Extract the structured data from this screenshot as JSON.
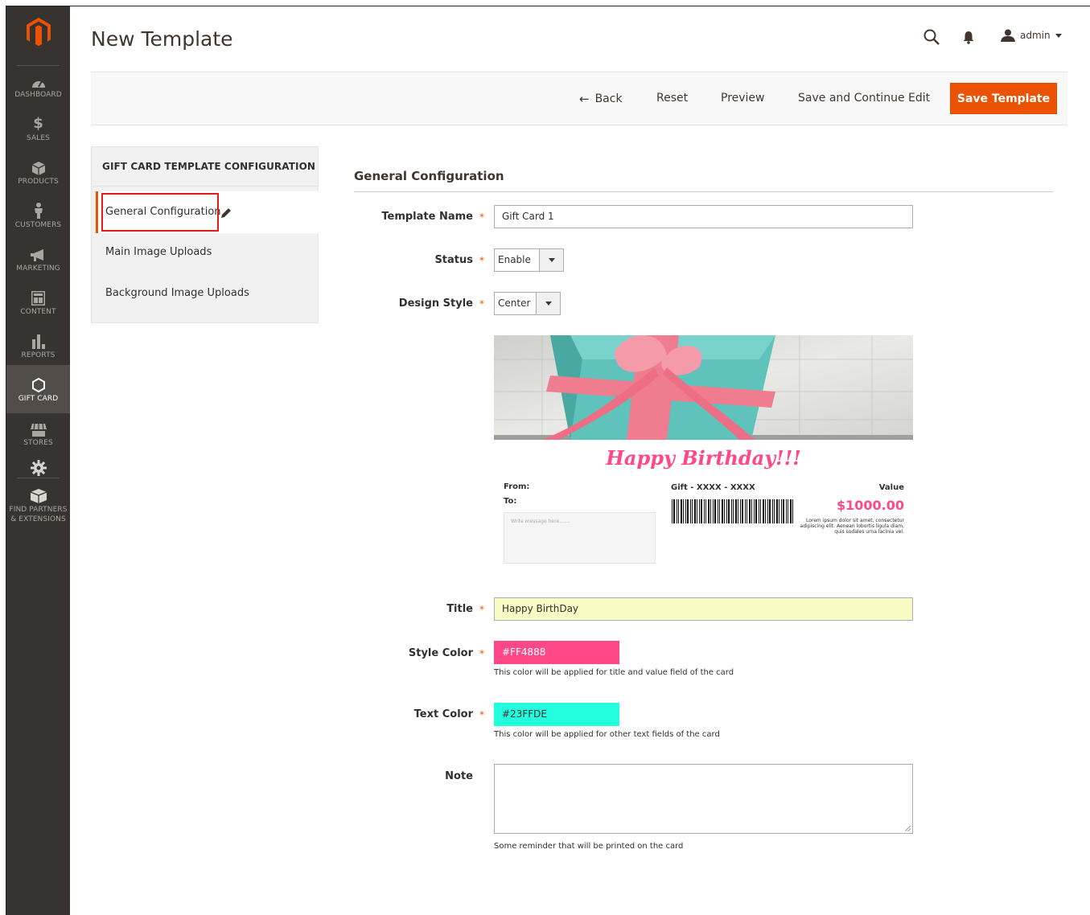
{
  "sidebar": {
    "logo": "magento-logo",
    "items": [
      {
        "label": "DASHBOARD",
        "icon": "dashboard-icon"
      },
      {
        "label": "SALES",
        "icon": "dollar-icon"
      },
      {
        "label": "PRODUCTS",
        "icon": "cube-icon"
      },
      {
        "label": "CUSTOMERS",
        "icon": "person-icon"
      },
      {
        "label": "MARKETING",
        "icon": "megaphone-icon"
      },
      {
        "label": "CONTENT",
        "icon": "layout-icon"
      },
      {
        "label": "REPORTS",
        "icon": "bar-chart-icon"
      },
      {
        "label": "GIFT CARD",
        "icon": "hexagon-icon",
        "active": true
      },
      {
        "label": "STORES",
        "icon": "store-icon"
      },
      {
        "label": "",
        "icon": "gear-icon"
      },
      {
        "label": "FIND PARTNERS & EXTENSIONS",
        "icon": "box-icon"
      }
    ]
  },
  "header": {
    "title": "New Template",
    "user": "admin"
  },
  "actions": {
    "back": "Back",
    "reset": "Reset",
    "preview": "Preview",
    "save_continue": "Save and Continue Edit",
    "save": "Save Template"
  },
  "config_panel": {
    "heading": "GIFT CARD TEMPLATE CONFIGURATION",
    "items": [
      "General Configuration",
      "Main Image Uploads",
      "Background Image Uploads"
    ]
  },
  "form": {
    "section_title": "General Configuration",
    "template_name": {
      "label": "Template Name",
      "value": "Gift Card 1"
    },
    "status": {
      "label": "Status",
      "value": "Enable"
    },
    "design_style": {
      "label": "Design Style",
      "value": "Center"
    },
    "title": {
      "label": "Title",
      "value": "Happy BirthDay",
      "bg": "#f9fbc4"
    },
    "style_color": {
      "label": "Style Color",
      "value": "#FF4888",
      "help": "This color will be applied for title and value field of the card"
    },
    "text_color": {
      "label": "Text Color",
      "value": "#23FFDE",
      "help": "This color will be applied for other text fields of the card"
    },
    "note": {
      "label": "Note",
      "help": "Some reminder that will be printed on the card"
    }
  },
  "card_preview": {
    "title": "Happy Birthday!!!",
    "from": "From:",
    "to": "To:",
    "message_placeholder": "Write message here.......",
    "gift_code": "Gift - XXXX - XXXX",
    "value_label": "Value",
    "value": "$1000.00",
    "lorem": "Lorem ipsum dolor sit amet, consectetur adipiscing elit. Aenean lobortis ligula diam, quis sodales urna lacinia vel."
  },
  "colors": {
    "accent": "#eb5202",
    "sidebar_bg": "#373330",
    "style_color": "#FF4888",
    "text_color": "#23FFDE"
  }
}
